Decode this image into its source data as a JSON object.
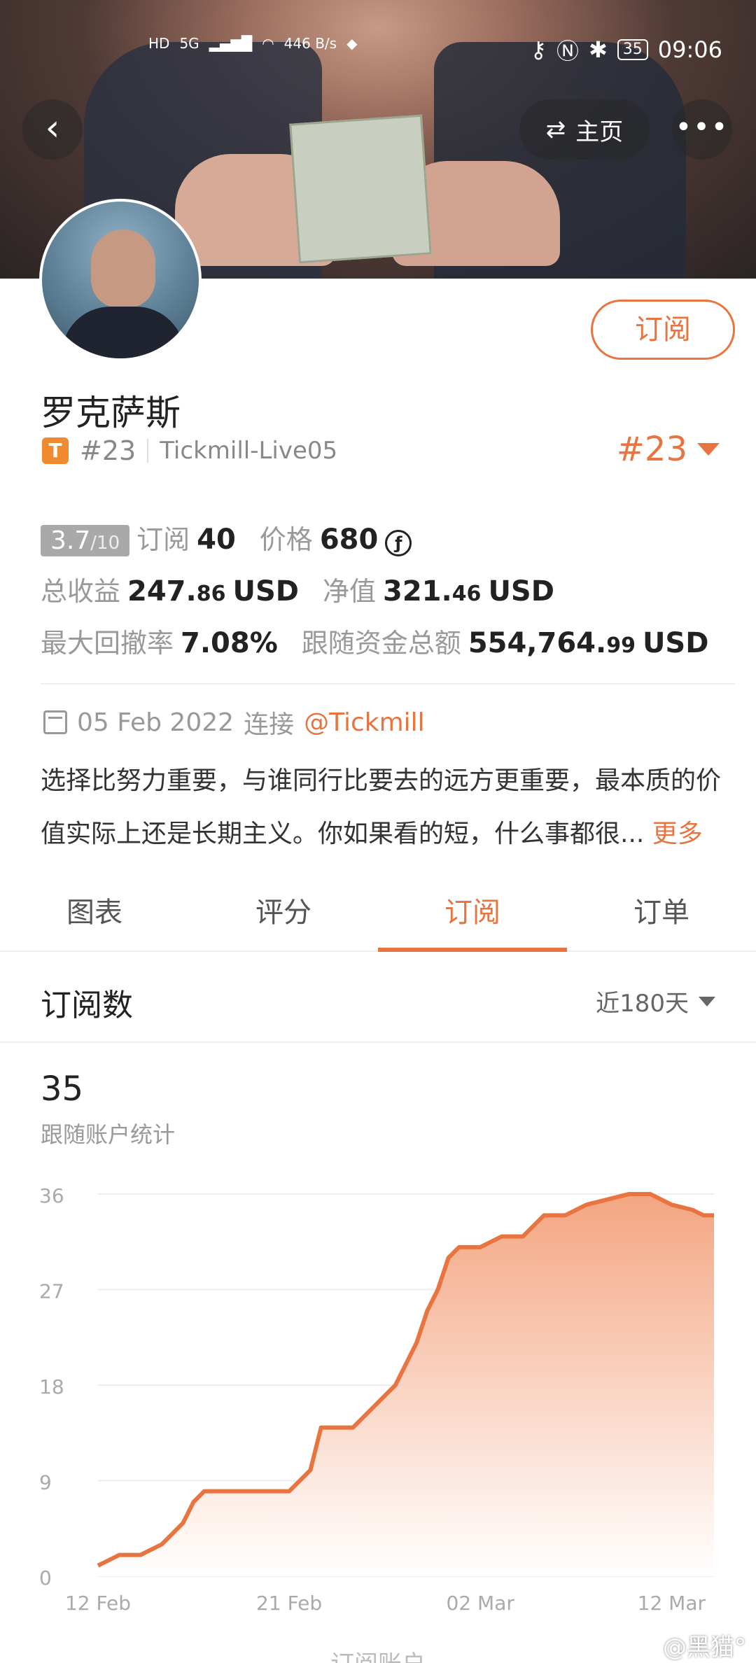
{
  "status_bar": {
    "left_icons": [
      "HD",
      "5G",
      "signal",
      "wifi"
    ],
    "net_speed": "446 B/s",
    "time": "09:06",
    "battery": "35"
  },
  "nav": {
    "home_label": "主页"
  },
  "profile": {
    "name": "罗克萨斯",
    "badge_letter": "T",
    "rank": "#23",
    "account": "Tickmill-Live05",
    "rank_dropdown": "#23",
    "subscribe_label": "订阅"
  },
  "stats": {
    "score": "3.7",
    "score_den": "/10",
    "subs_label": "订阅",
    "subs_value": "40",
    "price_label": "价格",
    "price_value": "680",
    "profit_label": "总收益",
    "profit_int": "247.",
    "profit_dec": "86",
    "profit_unit": "USD",
    "nav_label": "净值",
    "nav_int": "321.",
    "nav_dec": "46",
    "nav_unit": "USD",
    "dd_label": "最大回撤率",
    "dd_value": "7.08%",
    "fund_label": "跟随资金总额",
    "fund_int": "554,764.",
    "fund_dec": "99",
    "fund_unit": "USD"
  },
  "info": {
    "date": "05 Feb 2022",
    "connect_label": "连接",
    "broker_link": "@Tickmill",
    "description": "选择比努力重要，与谁同行比要去的远方更重要，最本质的价值实际上还是长期主义。你如果看的短，什么事都很...",
    "more_label": "更多"
  },
  "tabs": [
    "图表",
    "评分",
    "订阅",
    "订单"
  ],
  "active_tab": "订阅",
  "section": {
    "title": "订阅数",
    "range": "近180天",
    "count": "35",
    "count_label": "跟随账户统计"
  },
  "colors": {
    "accent": "#e8743f",
    "fill_top": "#f3a07a",
    "fill_bottom": "#ffffff"
  },
  "chart_data": {
    "type": "area",
    "y_ticks": [
      0,
      9,
      18,
      27,
      36
    ],
    "ylim": [
      0,
      36
    ],
    "x_ticks": [
      "12 Feb",
      "21 Feb",
      "02 Mar",
      "12 Mar"
    ],
    "x": [
      0,
      0.5,
      1,
      2,
      2.5,
      3,
      3.5,
      4,
      4.5,
      5,
      9,
      9.5,
      10,
      10.5,
      11,
      12,
      13,
      13.5,
      14,
      14.5,
      15,
      15.5,
      16,
      16.5,
      17,
      17.5,
      18,
      19,
      20,
      21,
      22,
      23,
      24,
      25,
      26,
      26.5,
      27,
      28,
      28.5,
      29
    ],
    "values": [
      1,
      1.5,
      2,
      2,
      2.5,
      3,
      4,
      5,
      7,
      8,
      8,
      9,
      10,
      14,
      14,
      14,
      16,
      17,
      18,
      20,
      22,
      25,
      27,
      30,
      31,
      31,
      31,
      32,
      32,
      34,
      34,
      35,
      35.5,
      36,
      36,
      35.5,
      35,
      34.5,
      34,
      34
    ],
    "x_unit": "days since 12 Feb"
  }
}
